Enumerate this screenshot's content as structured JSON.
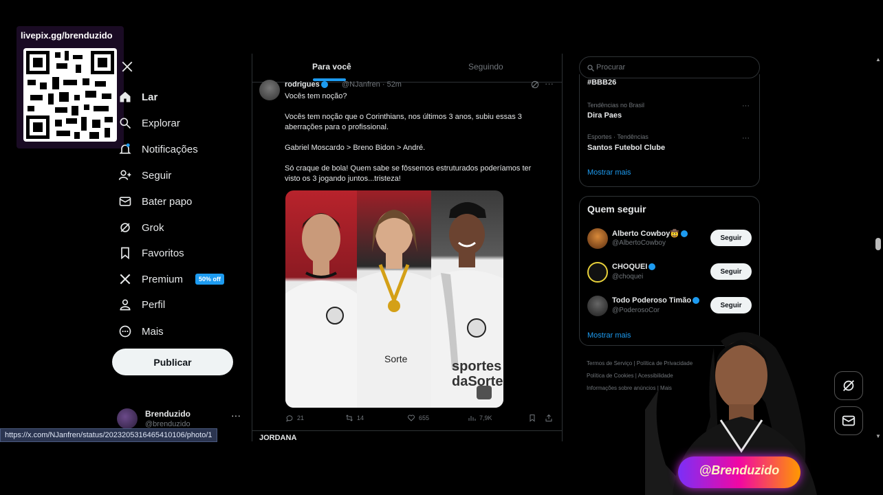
{
  "overlay": {
    "livepix_url": "livepix.gg/brenduzido",
    "stream_tag": "@Brenduzido"
  },
  "nav": {
    "items": [
      {
        "label": "Lar",
        "icon": "home-icon"
      },
      {
        "label": "Explorar",
        "icon": "search-icon"
      },
      {
        "label": "Notificações",
        "icon": "bell-icon"
      },
      {
        "label": "Seguir",
        "icon": "add-user-icon"
      },
      {
        "label": "Bater papo",
        "icon": "mail-icon"
      },
      {
        "label": "Grok",
        "icon": "grok-icon"
      },
      {
        "label": "Favoritos",
        "icon": "bookmark-icon"
      },
      {
        "label": "Premium",
        "icon": "x-logo-icon"
      },
      {
        "label": "Perfil",
        "icon": "user-icon"
      },
      {
        "label": "Mais",
        "icon": "more-circle-icon"
      }
    ],
    "premium_badge": "50% off",
    "publish_label": "Publicar"
  },
  "account": {
    "name": "Brenduzido",
    "handle": "@brenduzido",
    "more": "···"
  },
  "status_url": "https://x.com/NJanfren/status/2023205316465410106/photo/1",
  "main": {
    "tabs": [
      "Para você",
      "Seguindo"
    ],
    "tweet": {
      "name": "rodrigues",
      "handle_time": "@NJanfren · 52m",
      "lines": [
        "Vocês tem noção?",
        "Vocês tem noção que o Corinthians, nos últimos 3 anos, subiu essas 3",
        "aberrações para o profissional.",
        "Gabriel Moscardo > Breno Bidon > André.",
        "Só craque de bola! Quem sabe se fôssemos estruturados poderíamos ter",
        "visto os 3 jogando juntos...tristeza!"
      ],
      "actions": {
        "replies": "21",
        "retweets": "14",
        "likes": "655",
        "views": "7,9K"
      }
    },
    "next_tweet_name": "JORDANA"
  },
  "right": {
    "search_placeholder": "Procurar",
    "trends": {
      "partial": "#BBB26",
      "items": [
        {
          "meta": "Tendências no Brasil",
          "name": "Dira Paes"
        },
        {
          "meta": "Esportes · Tendências",
          "name": "Santos Futebol Clube"
        }
      ],
      "show_more": "Mostrar mais"
    },
    "who_to_follow": {
      "title": "Quem seguir",
      "accounts": [
        {
          "name": "Alberto Cowboy🤠",
          "handle": "@AlbertoCowboy",
          "button": "Seguir"
        },
        {
          "name": "CHOQUEI",
          "handle": "@choquei",
          "button": "Seguir"
        },
        {
          "name": "Todo Poderoso Timão",
          "handle": "@PoderosoCor",
          "button": "Seguir"
        }
      ],
      "show_more": "Mostrar mais"
    },
    "footer": [
      "Termos de Serviço  |  Política de Privacidade",
      "Política de Cookies  |  Acessibilidade",
      "Informações sobre anúncios  |  Mais"
    ]
  },
  "colors": {
    "accent": "#1d9bf0",
    "background": "#000000",
    "text": "#e7e9ea",
    "muted": "#71767b"
  }
}
